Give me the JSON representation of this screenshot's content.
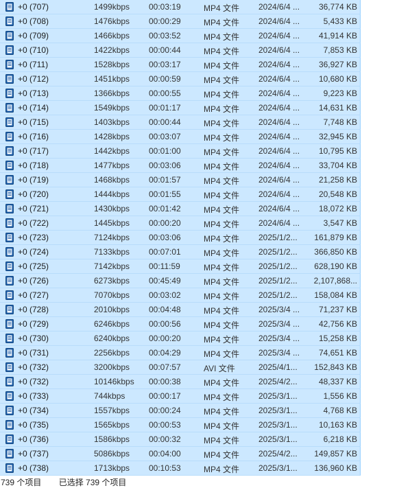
{
  "rows": [
    {
      "name": "+0 (707)",
      "bitrate": "1499kbps",
      "duration": "00:03:19",
      "type": "MP4 文件",
      "date": "2024/6/4 ...",
      "size": "36,774 KB"
    },
    {
      "name": "+0 (708)",
      "bitrate": "1476kbps",
      "duration": "00:00:29",
      "type": "MP4 文件",
      "date": "2024/6/4 ...",
      "size": "5,433 KB"
    },
    {
      "name": "+0 (709)",
      "bitrate": "1466kbps",
      "duration": "00:03:52",
      "type": "MP4 文件",
      "date": "2024/6/4 ...",
      "size": "41,914 KB"
    },
    {
      "name": "+0 (710)",
      "bitrate": "1422kbps",
      "duration": "00:00:44",
      "type": "MP4 文件",
      "date": "2024/6/4 ...",
      "size": "7,853 KB"
    },
    {
      "name": "+0 (711)",
      "bitrate": "1528kbps",
      "duration": "00:03:17",
      "type": "MP4 文件",
      "date": "2024/6/4 ...",
      "size": "36,927 KB"
    },
    {
      "name": "+0 (712)",
      "bitrate": "1451kbps",
      "duration": "00:00:59",
      "type": "MP4 文件",
      "date": "2024/6/4 ...",
      "size": "10,680 KB"
    },
    {
      "name": "+0 (713)",
      "bitrate": "1366kbps",
      "duration": "00:00:55",
      "type": "MP4 文件",
      "date": "2024/6/4 ...",
      "size": "9,223 KB"
    },
    {
      "name": "+0 (714)",
      "bitrate": "1549kbps",
      "duration": "00:01:17",
      "type": "MP4 文件",
      "date": "2024/6/4 ...",
      "size": "14,631 KB"
    },
    {
      "name": "+0 (715)",
      "bitrate": "1403kbps",
      "duration": "00:00:44",
      "type": "MP4 文件",
      "date": "2024/6/4 ...",
      "size": "7,748 KB"
    },
    {
      "name": "+0 (716)",
      "bitrate": "1428kbps",
      "duration": "00:03:07",
      "type": "MP4 文件",
      "date": "2024/6/4 ...",
      "size": "32,945 KB"
    },
    {
      "name": "+0 (717)",
      "bitrate": "1442kbps",
      "duration": "00:01:00",
      "type": "MP4 文件",
      "date": "2024/6/4 ...",
      "size": "10,795 KB"
    },
    {
      "name": "+0 (718)",
      "bitrate": "1477kbps",
      "duration": "00:03:06",
      "type": "MP4 文件",
      "date": "2024/6/4 ...",
      "size": "33,704 KB"
    },
    {
      "name": "+0 (719)",
      "bitrate": "1468kbps",
      "duration": "00:01:57",
      "type": "MP4 文件",
      "date": "2024/6/4 ...",
      "size": "21,258 KB"
    },
    {
      "name": "+0 (720)",
      "bitrate": "1444kbps",
      "duration": "00:01:55",
      "type": "MP4 文件",
      "date": "2024/6/4 ...",
      "size": "20,548 KB"
    },
    {
      "name": "+0 (721)",
      "bitrate": "1430kbps",
      "duration": "00:01:42",
      "type": "MP4 文件",
      "date": "2024/6/4 ...",
      "size": "18,072 KB"
    },
    {
      "name": "+0 (722)",
      "bitrate": "1445kbps",
      "duration": "00:00:20",
      "type": "MP4 文件",
      "date": "2024/6/4 ...",
      "size": "3,547 KB"
    },
    {
      "name": "+0 (723)",
      "bitrate": "7124kbps",
      "duration": "00:03:06",
      "type": "MP4 文件",
      "date": "2025/1/2...",
      "size": "161,879 KB"
    },
    {
      "name": "+0 (724)",
      "bitrate": "7133kbps",
      "duration": "00:07:01",
      "type": "MP4 文件",
      "date": "2025/1/2...",
      "size": "366,850 KB"
    },
    {
      "name": "+0 (725)",
      "bitrate": "7142kbps",
      "duration": "00:11:59",
      "type": "MP4 文件",
      "date": "2025/1/2...",
      "size": "628,190 KB"
    },
    {
      "name": "+0 (726)",
      "bitrate": "6273kbps",
      "duration": "00:45:49",
      "type": "MP4 文件",
      "date": "2025/1/2...",
      "size": "2,107,868..."
    },
    {
      "name": "+0 (727)",
      "bitrate": "7070kbps",
      "duration": "00:03:02",
      "type": "MP4 文件",
      "date": "2025/1/2...",
      "size": "158,084 KB"
    },
    {
      "name": "+0 (728)",
      "bitrate": "2010kbps",
      "duration": "00:04:48",
      "type": "MP4 文件",
      "date": "2025/3/4 ...",
      "size": "71,237 KB"
    },
    {
      "name": "+0 (729)",
      "bitrate": "6246kbps",
      "duration": "00:00:56",
      "type": "MP4 文件",
      "date": "2025/3/4 ...",
      "size": "42,756 KB"
    },
    {
      "name": "+0 (730)",
      "bitrate": "6240kbps",
      "duration": "00:00:20",
      "type": "MP4 文件",
      "date": "2025/3/4 ...",
      "size": "15,258 KB"
    },
    {
      "name": "+0 (731)",
      "bitrate": "2256kbps",
      "duration": "00:04:29",
      "type": "MP4 文件",
      "date": "2025/3/4 ...",
      "size": "74,651 KB"
    },
    {
      "name": "+0 (732)",
      "bitrate": "3200kbps",
      "duration": "00:07:57",
      "type": "AVI 文件",
      "date": "2025/4/1...",
      "size": "152,843 KB"
    },
    {
      "name": "+0 (732)",
      "bitrate": "10146kbps",
      "duration": "00:00:38",
      "type": "MP4 文件",
      "date": "2025/4/2...",
      "size": "48,337 KB"
    },
    {
      "name": "+0 (733)",
      "bitrate": "744kbps",
      "duration": "00:00:17",
      "type": "MP4 文件",
      "date": "2025/3/1...",
      "size": "1,556 KB"
    },
    {
      "name": "+0 (734)",
      "bitrate": "1557kbps",
      "duration": "00:00:24",
      "type": "MP4 文件",
      "date": "2025/3/1...",
      "size": "4,768 KB"
    },
    {
      "name": "+0 (735)",
      "bitrate": "1565kbps",
      "duration": "00:00:53",
      "type": "MP4 文件",
      "date": "2025/3/1...",
      "size": "10,163 KB"
    },
    {
      "name": "+0 (736)",
      "bitrate": "1586kbps",
      "duration": "00:00:32",
      "type": "MP4 文件",
      "date": "2025/3/1...",
      "size": "6,218 KB"
    },
    {
      "name": "+0 (737)",
      "bitrate": "5086kbps",
      "duration": "00:04:00",
      "type": "MP4 文件",
      "date": "2025/4/2...",
      "size": "149,857 KB"
    },
    {
      "name": "+0 (738)",
      "bitrate": "1713kbps",
      "duration": "00:10:53",
      "type": "MP4 文件",
      "date": "2025/3/1...",
      "size": "136,960 KB"
    }
  ],
  "status": {
    "item_count": "739 个项目",
    "selected_count": "已选择 739 个项目"
  },
  "colors": {
    "selected_row": "#cce8ff",
    "icon_blue": "#1f5fa8"
  },
  "icons": {
    "file": "video-file-icon"
  }
}
